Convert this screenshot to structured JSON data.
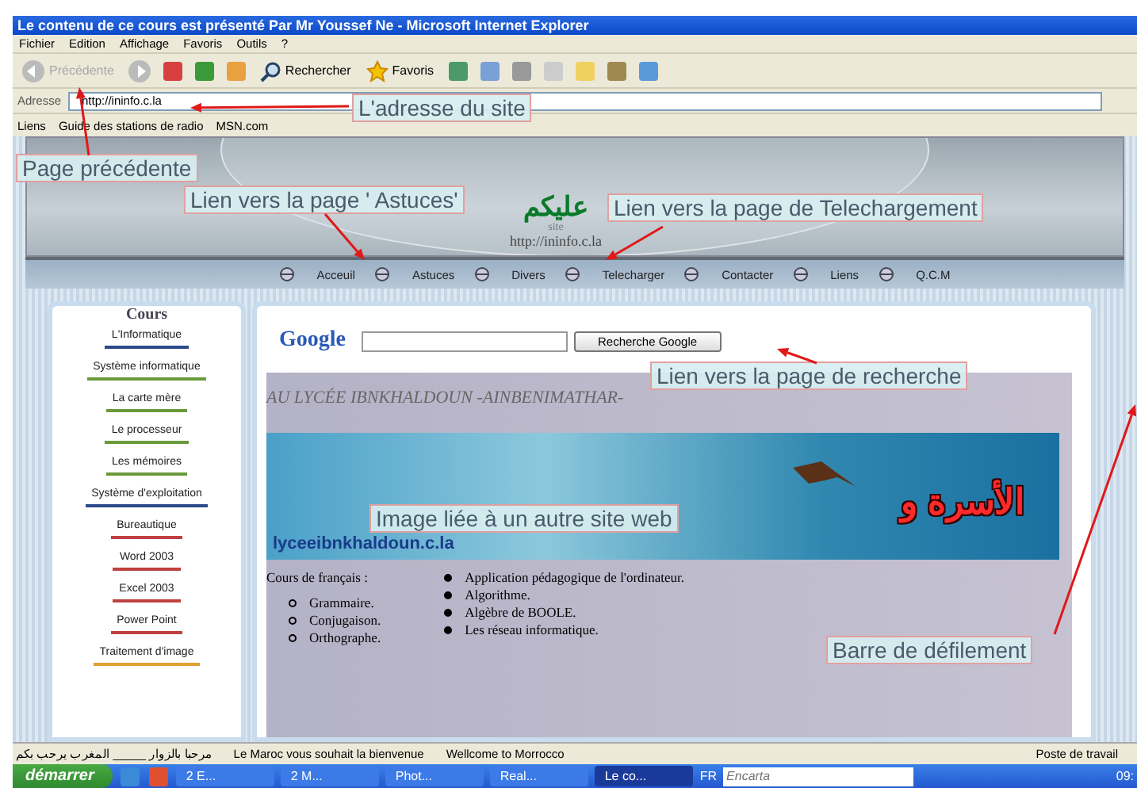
{
  "window": {
    "title": "Le contenu de ce cours est présenté Par Mr Youssef Ne - Microsoft Internet Explorer"
  },
  "menu": [
    "Fichier",
    "Edition",
    "Affichage",
    "Favoris",
    "Outils",
    "?"
  ],
  "toolbar": {
    "back": {
      "label": "Précédente",
      "disabled": true
    },
    "buttons": [
      {
        "label": "Rechercher",
        "kind": "search"
      },
      {
        "label": "Favoris",
        "kind": "star"
      }
    ]
  },
  "address_bar": {
    "label": "Adresse",
    "value": "http://ininfo.c.la"
  },
  "links_bar": {
    "label": "Liens",
    "items": [
      "Guide des stations de radio",
      "MSN.com"
    ]
  },
  "page": {
    "banner": {
      "arabic": "عليكم",
      "caption": "site",
      "url": "http://ininfo.c.la"
    },
    "nav": [
      "Acceuil",
      "Astuces",
      "Divers",
      "Telecharger",
      "Contacter",
      "Liens",
      "Q.C.M"
    ],
    "sidebar": {
      "title": "Cours",
      "items": [
        {
          "label": "L'Informatique",
          "color": "#2a4a8a"
        },
        {
          "label": "Système informatique",
          "color": "#6a9a3a"
        },
        {
          "label": "La carte mère",
          "color": "#6a9a3a"
        },
        {
          "label": "Le processeur",
          "color": "#6a9a3a"
        },
        {
          "label": "Les mémoires",
          "color": "#6a9a3a"
        },
        {
          "label": "Système d'exploitation",
          "color": "#2a4a8a"
        },
        {
          "label": "Bureautique",
          "color": "#c04040"
        },
        {
          "label": "Word 2003",
          "color": "#c04040"
        },
        {
          "label": "Excel 2003",
          "color": "#c04040"
        },
        {
          "label": "Power Point",
          "color": "#c04040"
        },
        {
          "label": "Traitement d'image",
          "color": "#e0a030"
        }
      ]
    },
    "search": {
      "logo": "Google",
      "button": "Recherche Google"
    },
    "marquee": "AU LYCÉE IBNKHALDOUN -AINBENIMATHAR-",
    "image_banner": {
      "arabic": "الأسرة و",
      "url": "lyceeibnkhaldoun.c.la"
    },
    "french": {
      "title": "Cours de français :",
      "items": [
        "Grammaire.",
        "Conjugaison.",
        "Orthographe."
      ]
    },
    "topics": [
      "Application pédagogique de l'ordinateur.",
      "Algorithme.",
      "Algèbre de BOOLE.",
      "Les réseau informatique."
    ]
  },
  "annotations": [
    "L'adresse du site",
    "Page précédente",
    "Lien vers la page ' Astuces'",
    "Lien vers la page de Telechargement",
    "Lien vers la page de recherche",
    "Image liée à un autre site web",
    "Barre de défilement"
  ],
  "status_bar": {
    "texts": [
      "مرحبا بالزوار _____ المغرب يرحب بكم",
      "Le Maroc vous souhait la bienvenue",
      "Wellcome to Morrocco"
    ],
    "zone": "Poste de travail"
  },
  "taskbar": {
    "start": "démarrer",
    "tasks": [
      {
        "label": "2 E...",
        "selected": false
      },
      {
        "label": "2 M...",
        "selected": false
      },
      {
        "label": "Phot...",
        "selected": false
      },
      {
        "label": "Real...",
        "selected": false
      },
      {
        "label": "Le co...",
        "selected": true
      }
    ],
    "language": "FR",
    "search_placeholder": "Encarta",
    "clock": "09:"
  }
}
